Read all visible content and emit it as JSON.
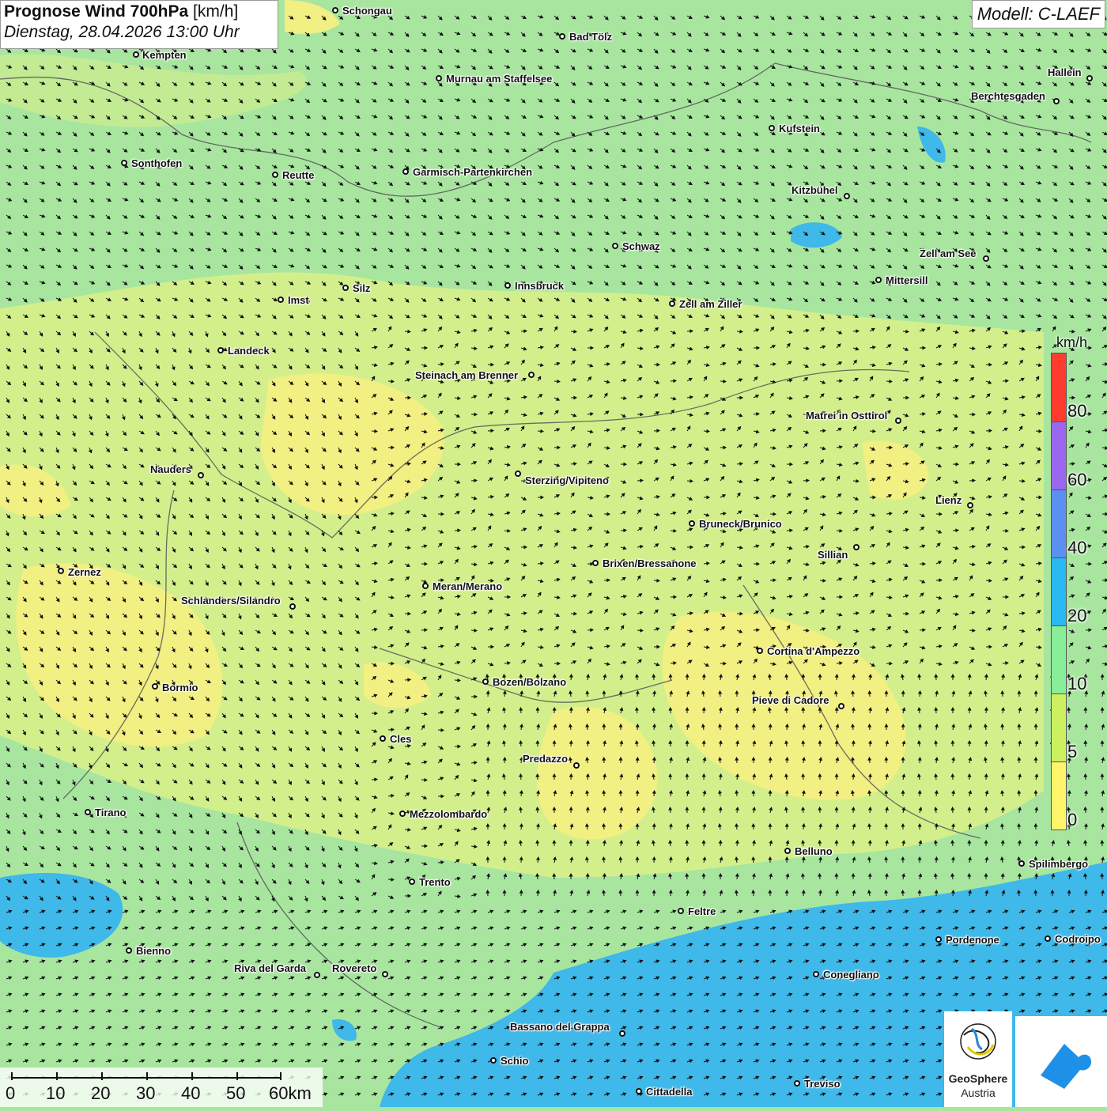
{
  "title": {
    "main_bold": "Prognose Wind 700hPa",
    "unit": "[km/h]",
    "datetime": "Dienstag, 28.04.2026 13:00 Uhr"
  },
  "model": "Modell: C-LAEF",
  "legend": {
    "unit": "km/h",
    "labels": [
      "80",
      "60",
      "40",
      "20",
      "10",
      "5",
      "0"
    ],
    "colors": {
      "80_plus": "#ff3b30",
      "60_80": "#9a66ee",
      "40_60": "#5b8ff0",
      "20_40": "#2ab8f0",
      "10_20": "#88ee99",
      "5_10": "#ccf060",
      "0_5": "#fff46a"
    }
  },
  "scale": {
    "labels": [
      "0",
      "10",
      "20",
      "30",
      "40",
      "50",
      "60km"
    ]
  },
  "logos": {
    "geosphere_line1": "GeoSphere",
    "geosphere_line2": "Austria",
    "geosphere_icon": "geosphere-logo-icon",
    "app_icon": "weather-app-logo-icon"
  },
  "cities": [
    {
      "name": "Schongau"
    },
    {
      "name": "Kempten"
    },
    {
      "name": "Bad Tölz"
    },
    {
      "name": "Murnau am Staffelsee"
    },
    {
      "name": "Hallein"
    },
    {
      "name": "Berchtesgaden"
    },
    {
      "name": "Kufstein"
    },
    {
      "name": "Sonthofen"
    },
    {
      "name": "Reutte"
    },
    {
      "name": "Garmisch-Partenkirchen"
    },
    {
      "name": "Kitzbühel"
    },
    {
      "name": "Schwaz"
    },
    {
      "name": "Zell am See"
    },
    {
      "name": "Mittersill"
    },
    {
      "name": "Silz"
    },
    {
      "name": "Innsbruck"
    },
    {
      "name": "Imst"
    },
    {
      "name": "Zell am Ziller"
    },
    {
      "name": "Landeck"
    },
    {
      "name": "Steinach am Brenner"
    },
    {
      "name": "Matrei in Osttirol"
    },
    {
      "name": "Nauders"
    },
    {
      "name": "Sterzing/Vipiteno"
    },
    {
      "name": "Lienz"
    },
    {
      "name": "Bruneck/Brunico"
    },
    {
      "name": "Sillian"
    },
    {
      "name": "Zernez"
    },
    {
      "name": "Brixen/Bressanone"
    },
    {
      "name": "Meran/Merano"
    },
    {
      "name": "Schlanders/Silandro"
    },
    {
      "name": "Cortina d'Ampezzo"
    },
    {
      "name": "Bozen/Bolzano"
    },
    {
      "name": "Bormio"
    },
    {
      "name": "Pieve di Cadore"
    },
    {
      "name": "Cles"
    },
    {
      "name": "Predazzo"
    },
    {
      "name": "Tirano"
    },
    {
      "name": "Mezzolombardo"
    },
    {
      "name": "Belluno"
    },
    {
      "name": "Spilimbergo"
    },
    {
      "name": "Trento"
    },
    {
      "name": "Feltre"
    },
    {
      "name": "Pordenone"
    },
    {
      "name": "Codroipo"
    },
    {
      "name": "Bienno"
    },
    {
      "name": "Riva del Garda"
    },
    {
      "name": "Rovereto"
    },
    {
      "name": "Conegliano"
    },
    {
      "name": "Bassano del Grappa"
    },
    {
      "name": "Schio"
    },
    {
      "name": "Treviso"
    },
    {
      "name": "Cittadella"
    }
  ]
}
